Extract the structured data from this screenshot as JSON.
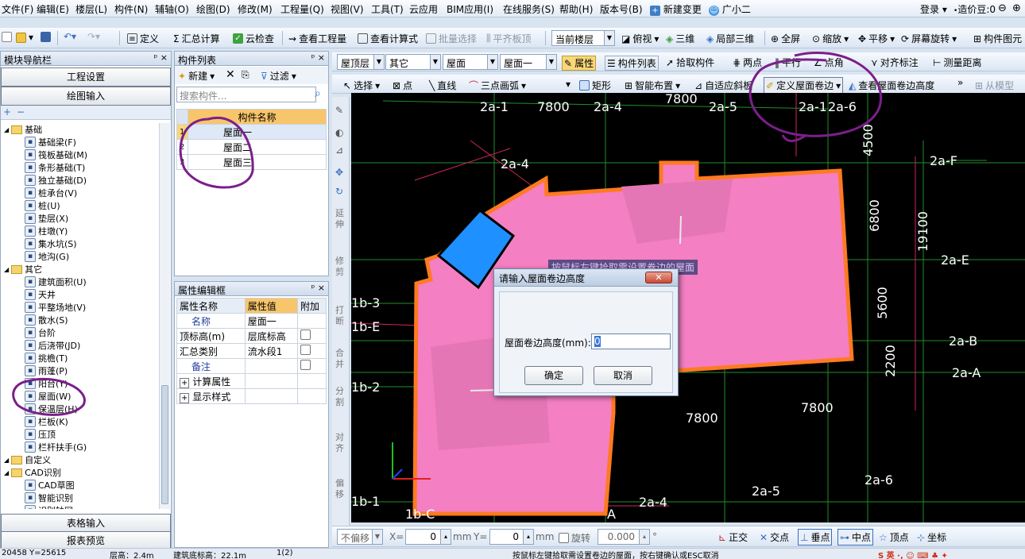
{
  "menu": [
    "文件(F)",
    "编辑(E)",
    "楼层(L)",
    "构件(N)",
    "辅轴(O)",
    "绘图(D)",
    "修改(M)",
    "工程量(Q)",
    "视图(V)",
    "工具(T)",
    "云应用",
    "BIM应用(I)",
    "在线服务(S)",
    "帮助(H)",
    "版本号(B)",
    "新建变更",
    "广小二"
  ],
  "login": "登录",
  "coins": "造价豆:0",
  "toolbar1": {
    "define": "定义",
    "sum": "汇总计算",
    "cloud_check": "云检查",
    "view_qty": "查看工程量",
    "view_formula": "查看计算式",
    "batch_select": "批量选择",
    "flush_top": "平齐板顶",
    "floor_select": "当前楼层",
    "top_view": "俯视",
    "three_d": "三维",
    "local_3d": "局部三维",
    "fullscreen": "全屏",
    "zoom": "缩放",
    "pan": "平移",
    "rotate": "屏幕旋转",
    "component_ref": "构件图元"
  },
  "toolbar2": {
    "floor": "屋顶层",
    "category": "其它",
    "type": "屋面",
    "component": "屋面一",
    "properties": "属性",
    "comp_list": "构件列表",
    "pick": "拾取构件",
    "two_point": "两点",
    "parallel": "平行",
    "point_angle": "点角",
    "align_mark": "对齐标注",
    "measure": "测量距离"
  },
  "toolbar3": {
    "select": "选择",
    "point": "点",
    "line": "直线",
    "arc": "三点画弧",
    "rect": "矩形",
    "smart": "智能布置",
    "adaptive": "自适应斜板",
    "define_edge": "定义屋面卷边",
    "view_edge": "查看屋面卷边高度",
    "from_model": "从模型"
  },
  "nav": {
    "title": "模块导航栏",
    "btn_settings": "工程设置",
    "btn_draw": "绘图输入",
    "btn_table": "表格输入",
    "btn_report": "报表预览",
    "items": [
      {
        "label": "基础",
        "kind": "folder"
      },
      {
        "label": "基础梁(F)",
        "kind": "item"
      },
      {
        "label": "筏板基础(M)",
        "kind": "item"
      },
      {
        "label": "条形基础(T)",
        "kind": "item"
      },
      {
        "label": "独立基础(D)",
        "kind": "item"
      },
      {
        "label": "桩承台(V)",
        "kind": "item"
      },
      {
        "label": "桩(U)",
        "kind": "item"
      },
      {
        "label": "垫层(X)",
        "kind": "item"
      },
      {
        "label": "柱墩(Y)",
        "kind": "item"
      },
      {
        "label": "集水坑(S)",
        "kind": "item"
      },
      {
        "label": "地沟(G)",
        "kind": "item"
      },
      {
        "label": "其它",
        "kind": "folder"
      },
      {
        "label": "建筑面积(U)",
        "kind": "item"
      },
      {
        "label": "天井",
        "kind": "item"
      },
      {
        "label": "平整场地(V)",
        "kind": "item"
      },
      {
        "label": "散水(S)",
        "kind": "item"
      },
      {
        "label": "台阶",
        "kind": "item"
      },
      {
        "label": "后浇带(JD)",
        "kind": "item"
      },
      {
        "label": "挑檐(T)",
        "kind": "item"
      },
      {
        "label": "雨蓬(P)",
        "kind": "item"
      },
      {
        "label": "阳台(Y)",
        "kind": "item"
      },
      {
        "label": "屋面(W)",
        "kind": "item"
      },
      {
        "label": "保温层(H)",
        "kind": "item"
      },
      {
        "label": "栏板(K)",
        "kind": "item"
      },
      {
        "label": "压顶",
        "kind": "item"
      },
      {
        "label": "栏杆扶手(G)",
        "kind": "item"
      },
      {
        "label": "自定义",
        "kind": "folder"
      },
      {
        "label": "CAD识别",
        "kind": "folder"
      },
      {
        "label": "CAD草图",
        "kind": "item"
      },
      {
        "label": "智能识别",
        "kind": "item"
      },
      {
        "label": "识别轴网",
        "kind": "item"
      }
    ]
  },
  "complist": {
    "title": "构件列表",
    "new_btn": "新建",
    "filter_btn": "过滤",
    "search_placeholder": "搜索构件...",
    "col_name": "构件名称",
    "rows": [
      {
        "idx": "1",
        "name": "屋面一"
      },
      {
        "idx": "2",
        "name": "屋面二"
      },
      {
        "idx": "3",
        "name": "屋面三"
      }
    ]
  },
  "props": {
    "title": "属性编辑框",
    "col_name": "属性名称",
    "col_value": "属性值",
    "col_extra": "附加",
    "rows": [
      {
        "name": "名称",
        "value": "屋面一"
      },
      {
        "name": "顶标高(m)",
        "value": "层底标高"
      },
      {
        "name": "汇总类别",
        "value": "流水段1"
      },
      {
        "name": "备注",
        "value": ""
      },
      {
        "name": "计算属性",
        "value": ""
      },
      {
        "name": "显示样式",
        "value": ""
      }
    ]
  },
  "side_tools": [
    "延伸",
    "修剪",
    "打断",
    "合并",
    "分割",
    "对齐",
    "偏移"
  ],
  "canvas": {
    "labels": [
      "2a-1",
      "7800",
      "2a-4",
      "7800",
      "2a-5",
      "2a-1",
      "2a-6",
      "4500",
      "2a-4",
      "2a-F",
      "6800",
      "19100",
      "2a-E",
      "1b-3",
      "1b-E",
      "5600",
      "2a-B",
      "2200",
      "2a-A",
      "1b-2",
      "7800",
      "7800",
      "2a-6",
      "1b-1",
      "1b-C",
      "A",
      "2a-4",
      "2a-5"
    ],
    "hint": "按鼠标左键拾取需设置卷边的屋面"
  },
  "dialog": {
    "title": "请输入屋面卷边高度",
    "field_label": "屋面卷边高度(mm):",
    "field_value": "0",
    "ok": "确定",
    "cancel": "取消"
  },
  "bottom": {
    "no_offset": "不偏移",
    "x_label": "X=",
    "x_value": "0",
    "mm1": "mm",
    "y_label": "Y=",
    "y_value": "0",
    "mm2": "mm",
    "rotate_label": "旋转",
    "rotate_value": "0.000",
    "deg": "°",
    "ortho": "正交",
    "cross": "交点",
    "perp": "垂点",
    "mid": "中点",
    "vertex": "顶点",
    "coord": "坐标"
  },
  "status": {
    "coords": "20458 Y=25615",
    "floor_height": "层高：2.4m",
    "base_elev": "建筑底标高：22.1m",
    "count": "1(2)",
    "tip": "按鼠标左键拾取需设置卷边的屋面，按右键确认或ESC取消"
  }
}
